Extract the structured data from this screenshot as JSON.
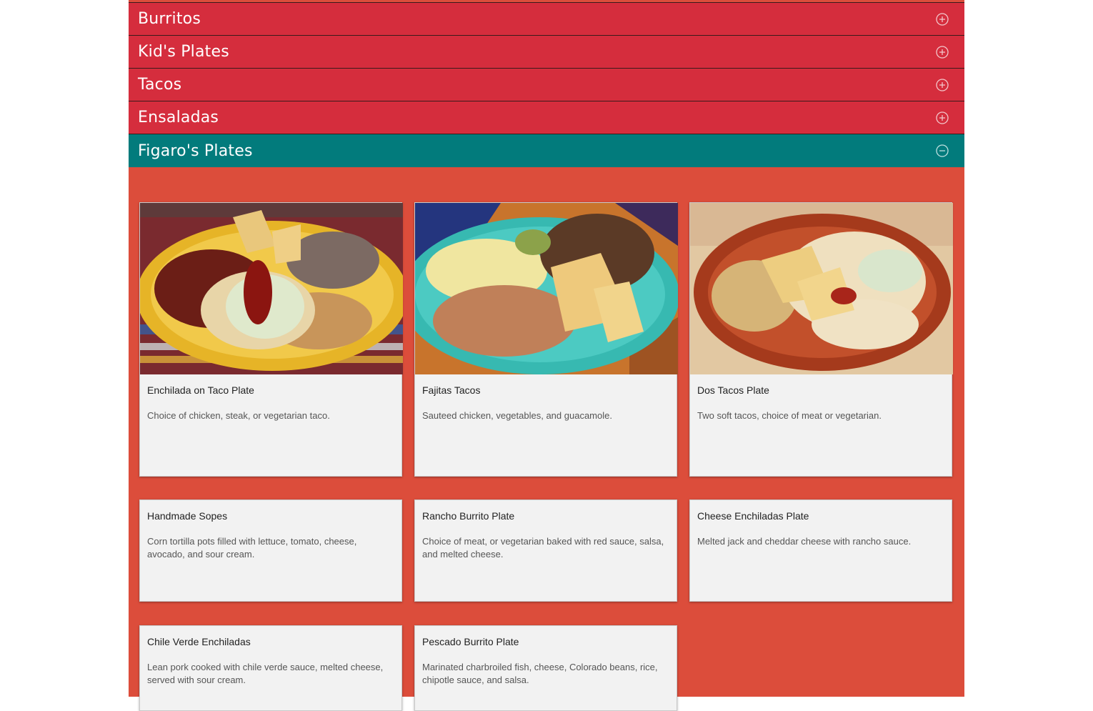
{
  "accordion": [
    {
      "label": "Burritos",
      "state": "collapsed"
    },
    {
      "label": "Kid's Plates",
      "state": "collapsed"
    },
    {
      "label": "Tacos",
      "state": "collapsed"
    },
    {
      "label": "Ensaladas",
      "state": "collapsed"
    },
    {
      "label": "Figaro's Plates",
      "state": "expanded"
    }
  ],
  "icons": {
    "collapsed": "plus-circle-icon",
    "expanded": "minus-circle-icon"
  },
  "colors": {
    "collapsed_header": "#d52d3d",
    "expanded_header": "#027b7c",
    "panel_background": "#dc4d3b",
    "card_background": "#f2f2f2"
  },
  "menu_items": [
    {
      "name": "Enchilada on Taco Plate",
      "description": "Choice of chicken, steak, or vegetarian taco.",
      "photo": "yellow-plate"
    },
    {
      "name": "Fajitas Tacos",
      "description": "Sauteed chicken, vegetables, and guacamole.",
      "photo": "turquoise-plate"
    },
    {
      "name": "Dos Tacos Plate",
      "description": "Two soft tacos, choice of meat or vegetarian.",
      "photo": "red-plate"
    },
    {
      "name": "Handmade Sopes",
      "description": "Corn tortilla pots filled with lettuce, tomato, cheese, avocado, and sour cream."
    },
    {
      "name": "Rancho Burrito Plate",
      "description": "Choice of meat, or vegetarian baked with red sauce, salsa, and melted cheese."
    },
    {
      "name": "Cheese Enchiladas Plate",
      "description": "Melted jack and cheddar cheese with rancho sauce."
    },
    {
      "name": "Chile Verde Enchiladas",
      "description": "Lean pork cooked with chile verde sauce, melted cheese, served with sour cream."
    },
    {
      "name": "Pescado Burrito Plate",
      "description": "Marinated charbroiled fish, cheese, Colorado beans, rice, chipotle sauce, and salsa."
    }
  ]
}
